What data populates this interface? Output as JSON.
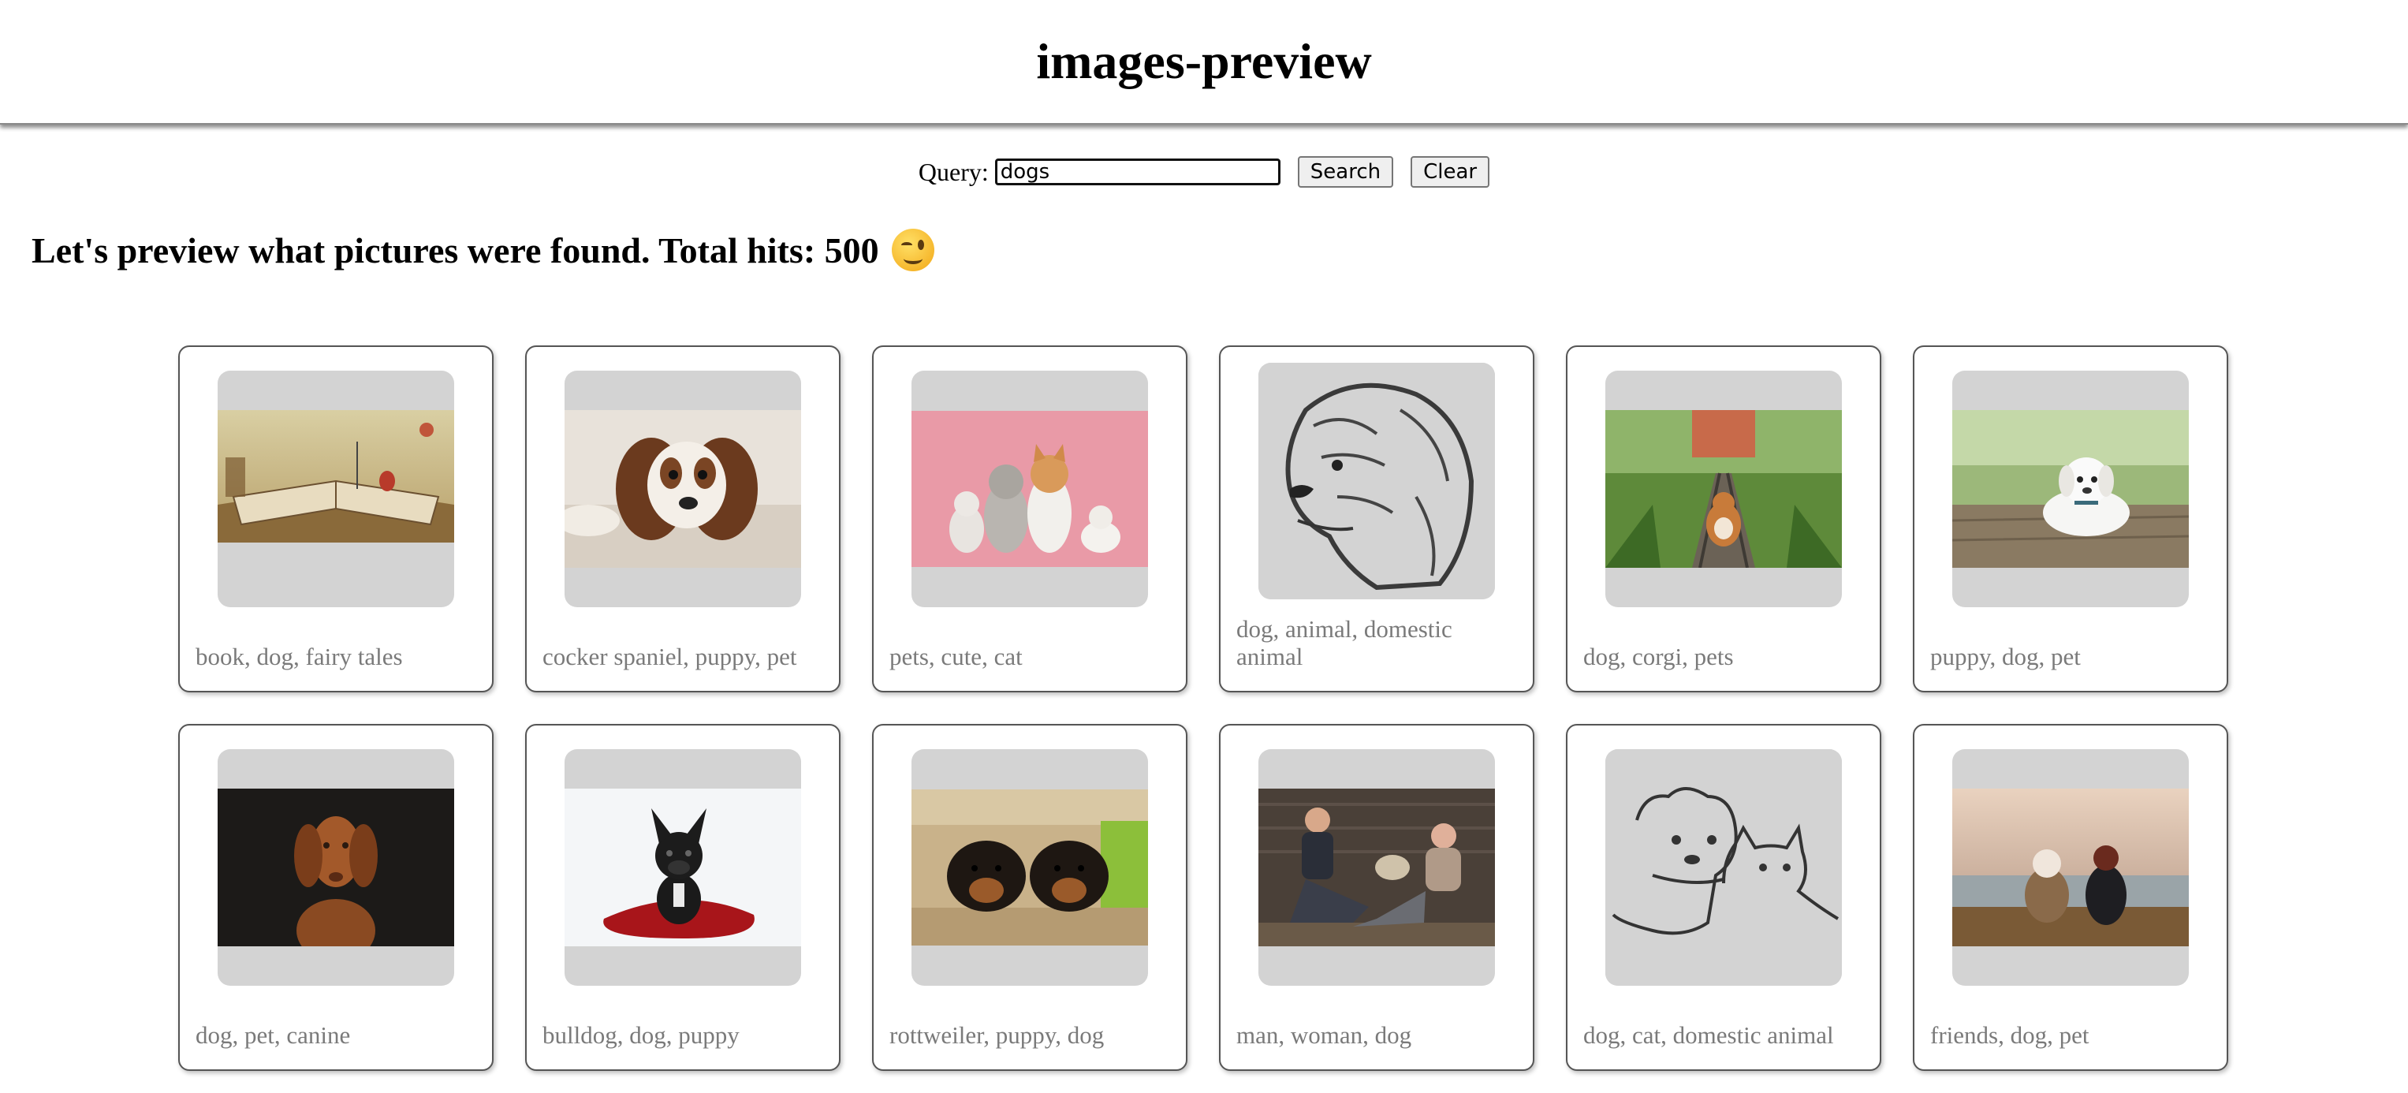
{
  "app": {
    "title": "images-preview"
  },
  "search": {
    "label": "Query:",
    "value": "dogs",
    "search_button": "Search",
    "clear_button": "Clear"
  },
  "results": {
    "heading": "Let's preview what pictures were found. Total hits: 500"
  },
  "cards": [
    {
      "caption": "book, dog, fairy tales"
    },
    {
      "caption": "cocker spaniel, puppy, pet"
    },
    {
      "caption": "pets, cute, cat"
    },
    {
      "caption": "dog, animal, domestic animal"
    },
    {
      "caption": "dog, corgi, pets"
    },
    {
      "caption": "puppy, dog, pet"
    },
    {
      "caption": "dog, pet, canine"
    },
    {
      "caption": "bulldog, dog, puppy"
    },
    {
      "caption": "rottweiler, puppy, dog"
    },
    {
      "caption": "man, woman, dog"
    },
    {
      "caption": "dog, cat, domestic animal"
    },
    {
      "caption": "friends, dog, pet"
    }
  ]
}
